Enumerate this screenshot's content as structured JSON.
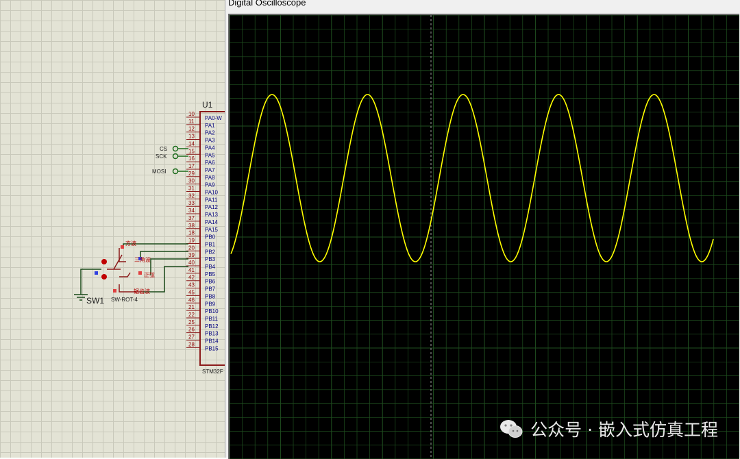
{
  "scope": {
    "title": "Digital Oscilloscope",
    "trace_color": "#ffff00",
    "grid_color": "#1f4f1f",
    "background_color": "#000000",
    "cycles_visible": 5
  },
  "schematic": {
    "component": {
      "ref": "U1",
      "part": "STM32F",
      "pins": [
        {
          "num": "10",
          "name": "PA0-W"
        },
        {
          "num": "11",
          "name": "PA1"
        },
        {
          "num": "12",
          "name": "PA2"
        },
        {
          "num": "13",
          "name": "PA3"
        },
        {
          "num": "14",
          "name": "PA4"
        },
        {
          "num": "15",
          "name": "PA5"
        },
        {
          "num": "16",
          "name": "PA6"
        },
        {
          "num": "17",
          "name": "PA7"
        },
        {
          "num": "29",
          "name": "PA8"
        },
        {
          "num": "30",
          "name": "PA9"
        },
        {
          "num": "31",
          "name": "PA10"
        },
        {
          "num": "32",
          "name": "PA11"
        },
        {
          "num": "33",
          "name": "PA12"
        },
        {
          "num": "34",
          "name": "PA13"
        },
        {
          "num": "37",
          "name": "PA14"
        },
        {
          "num": "38",
          "name": "PA15"
        },
        {
          "num": "18",
          "name": "PB0"
        },
        {
          "num": "19",
          "name": "PB1"
        },
        {
          "num": "20",
          "name": "PB2"
        },
        {
          "num": "39",
          "name": "PB3"
        },
        {
          "num": "40",
          "name": "PB4"
        },
        {
          "num": "41",
          "name": "PB5"
        },
        {
          "num": "42",
          "name": "PB6"
        },
        {
          "num": "43",
          "name": "PB7"
        },
        {
          "num": "45",
          "name": "PB8"
        },
        {
          "num": "46",
          "name": "PB9"
        },
        {
          "num": "21",
          "name": "PB10"
        },
        {
          "num": "22",
          "name": "PB11"
        },
        {
          "num": "25",
          "name": "PB12"
        },
        {
          "num": "26",
          "name": "PB13"
        },
        {
          "num": "27",
          "name": "PB14"
        },
        {
          "num": "28",
          "name": "PB15"
        }
      ]
    },
    "net_labels": {
      "cs": "CS",
      "sck": "SCK",
      "mosi": "MOSI"
    },
    "switch": {
      "ref": "SW1",
      "part": "SW-ROT-4",
      "positions": [
        "方波",
        "三角波",
        "正弦",
        "锯齿波"
      ]
    }
  },
  "watermark": {
    "text": "公众号 · 嵌入式仿真工程"
  }
}
